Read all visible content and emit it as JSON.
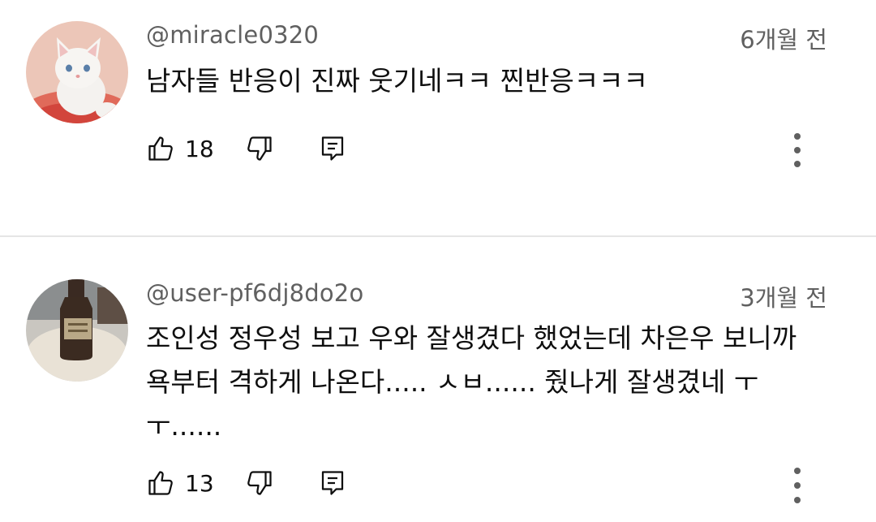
{
  "comments": [
    {
      "username": "@miracle0320",
      "time": "6개월 전",
      "text": "남자들 반응이 진짜 웃기네ㅋㅋ 찐반응ㅋㅋㅋ",
      "likes": "18",
      "avatar_icon": "white-kitten-avatar"
    },
    {
      "username": "@user-pf6dj8do2o",
      "time": "3개월 전",
      "text": "조인성 정우성 보고 우와 잘생겼다 했었는데 차은우 보니까\n욕부터 격하게 나온다..... ㅅㅂ...... 줬나게 잘생겼네 ㅜ\nㅜ......",
      "likes": "13",
      "avatar_icon": "bottle-avatar"
    }
  ],
  "icons": {
    "like": "thumbs-up-icon",
    "dislike": "thumbs-down-icon",
    "reply": "reply-icon",
    "more": "more-vert-icon"
  }
}
